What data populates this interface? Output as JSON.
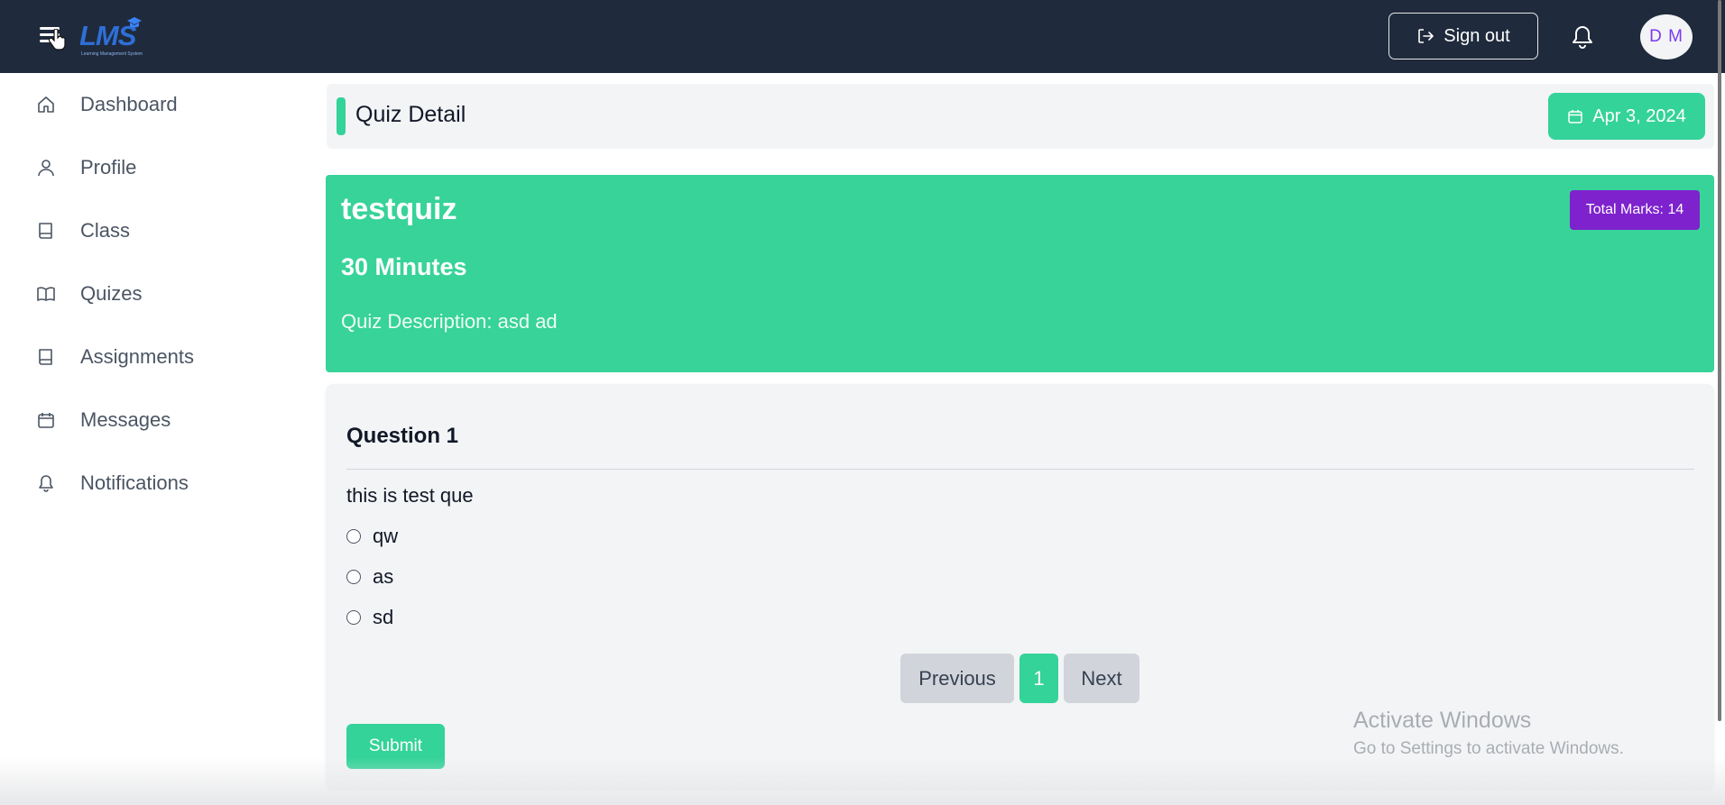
{
  "app": {
    "logo_text": "LMS",
    "logo_subtitle": "Learning Management System"
  },
  "topbar": {
    "signout_label": "Sign out",
    "avatar_initials": "D M"
  },
  "sidebar": {
    "items": [
      {
        "label": "Dashboard",
        "icon": "home-icon"
      },
      {
        "label": "Profile",
        "icon": "user-icon"
      },
      {
        "label": "Class",
        "icon": "book-icon"
      },
      {
        "label": "Quizes",
        "icon": "open-book-icon"
      },
      {
        "label": "Assignments",
        "icon": "book-icon"
      },
      {
        "label": "Messages",
        "icon": "calendar-icon"
      },
      {
        "label": "Notifications",
        "icon": "bell-icon"
      }
    ]
  },
  "header": {
    "title": "Quiz Detail",
    "date": "Apr 3, 2024"
  },
  "quiz": {
    "title": "testquiz",
    "duration": "30 Minutes",
    "description": "Quiz Description: asd ad",
    "total_marks": "Total Marks: 14"
  },
  "question": {
    "heading": "Question 1",
    "text": "this is test que",
    "options": [
      "qw",
      "as",
      "sd"
    ]
  },
  "pagination": {
    "previous_label": "Previous",
    "current_page": "1",
    "next_label": "Next"
  },
  "actions": {
    "submit_label": "Submit"
  },
  "watermark": {
    "line1": "Activate Windows",
    "line2": "Go to Settings to activate Windows."
  },
  "colors": {
    "topbar": "#1f2a3c",
    "accent": "#34d399",
    "badge": "#7e22ce"
  }
}
